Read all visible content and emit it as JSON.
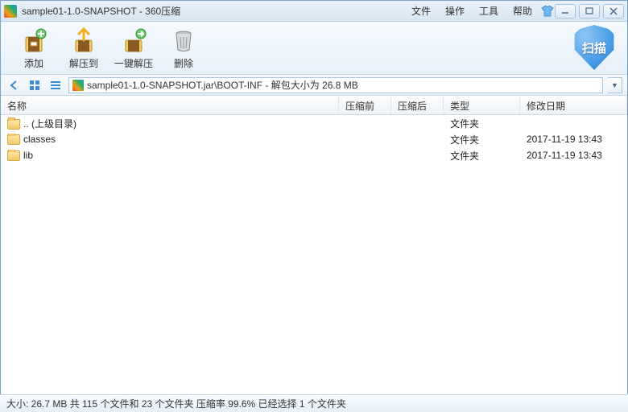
{
  "window": {
    "title": "sample01-1.0-SNAPSHOT - 360压缩"
  },
  "menu": {
    "file": "文件",
    "operate": "操作",
    "tools": "工具",
    "help": "帮助"
  },
  "toolbar": {
    "add": "添加",
    "extract_to": "解压到",
    "one_click": "一键解压",
    "delete": "删除",
    "scan": "扫描"
  },
  "path": {
    "text": "sample01-1.0-SNAPSHOT.jar\\BOOT-INF - 解包大小为 26.8 MB"
  },
  "columns": {
    "name": "名称",
    "before": "压缩前",
    "after": "压缩后",
    "type": "类型",
    "date": "修改日期"
  },
  "rows": [
    {
      "name": ".. (上级目录)",
      "before": "",
      "after": "",
      "type": "文件夹",
      "date": ""
    },
    {
      "name": "classes",
      "before": "",
      "after": "",
      "type": "文件夹",
      "date": "2017-11-19 13:43"
    },
    {
      "name": "lib",
      "before": "",
      "after": "",
      "type": "文件夹",
      "date": "2017-11-19 13:43"
    }
  ],
  "status": {
    "text": "大小: 26.7 MB 共 115 个文件和 23 个文件夹 压缩率 99.6% 已经选择 1 个文件夹"
  }
}
